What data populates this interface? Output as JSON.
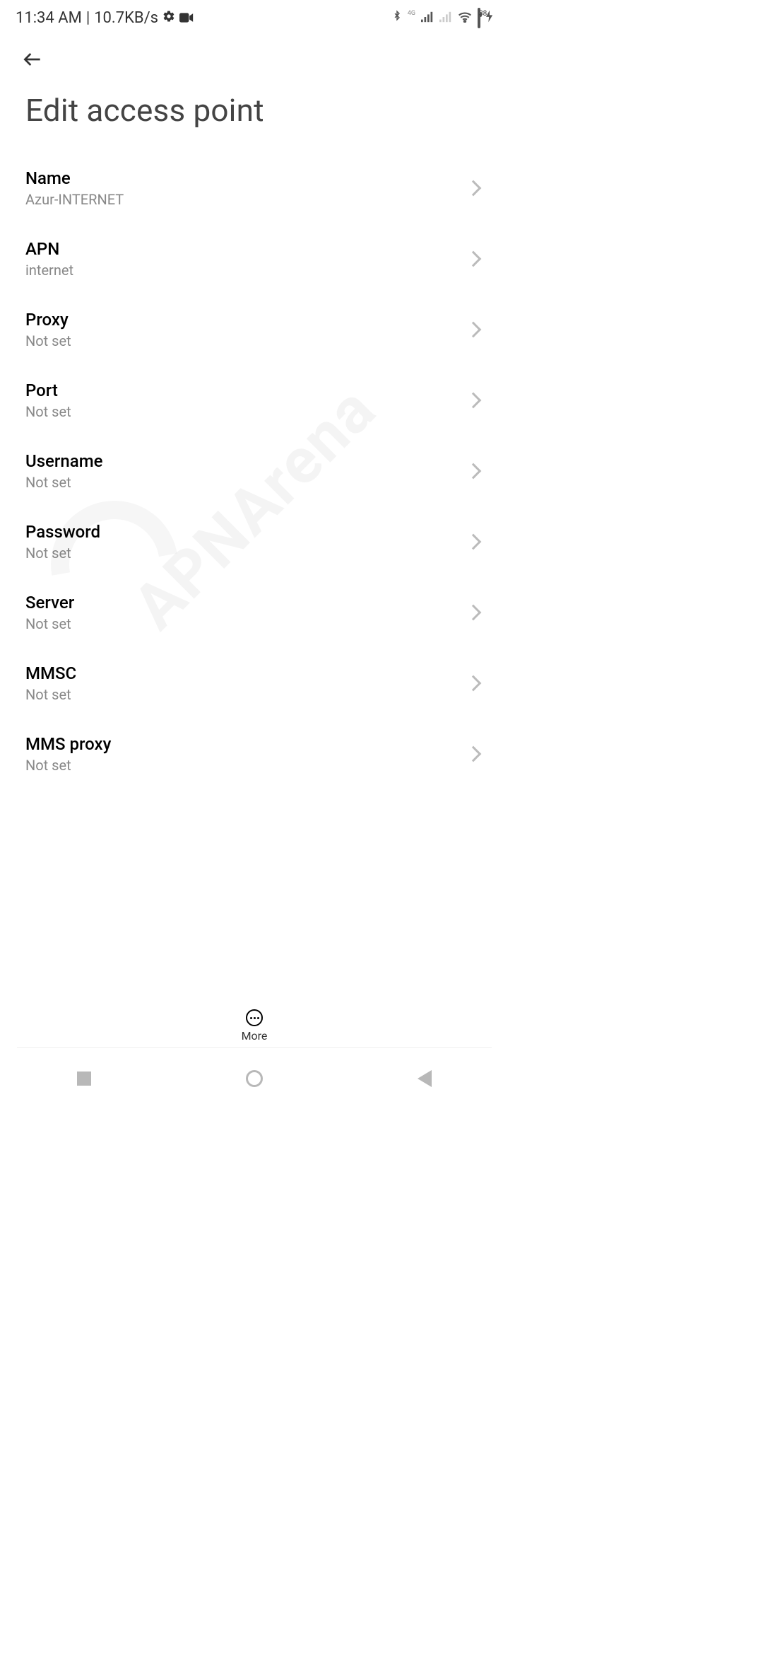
{
  "status": {
    "time": "11:34 AM",
    "sep": " | ",
    "speed": "10.7KB/s",
    "net_label_4g": "4G",
    "battery_pct": "38"
  },
  "header": {
    "title": "Edit access point"
  },
  "settings": [
    {
      "label": "Name",
      "value": "Azur-INTERNET"
    },
    {
      "label": "APN",
      "value": "internet"
    },
    {
      "label": "Proxy",
      "value": "Not set"
    },
    {
      "label": "Port",
      "value": "Not set"
    },
    {
      "label": "Username",
      "value": "Not set"
    },
    {
      "label": "Password",
      "value": "Not set"
    },
    {
      "label": "Server",
      "value": "Not set"
    },
    {
      "label": "MMSC",
      "value": "Not set"
    },
    {
      "label": "MMS proxy",
      "value": "Not set"
    }
  ],
  "more_label": "More",
  "watermark": "APNArena"
}
